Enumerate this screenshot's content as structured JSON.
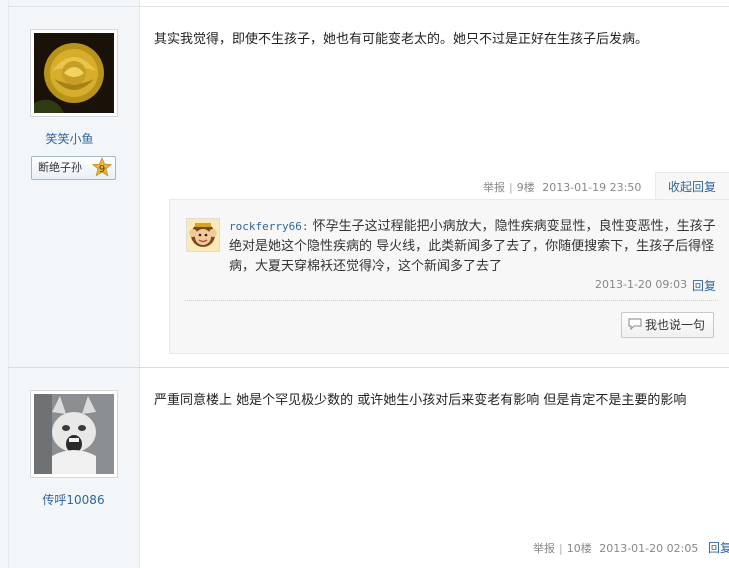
{
  "posts": [
    {
      "username": "笑笑小鱼",
      "badge": "断绝子孙",
      "level": "9",
      "text": "其实我觉得，即使不生孩子，她也有可能变老太的。她只不过是正好在生孩子后发病。",
      "report": "举报",
      "floor": "9楼",
      "time": "2013-01-19 23:50",
      "collapse": "收起回复",
      "replies": [
        {
          "user": "rockferry66:",
          "text": "怀孕生子这过程能把小病放大，隐性疾病变显性，良性变恶性，生孩子绝对是她这个隐性疾病的 导火线，此类新闻多了去了，你随便搜索下，生孩子后得怪病，大夏天穿棉袄还觉得冷，这个新闻多了去了",
          "time": "2013-1-20 09:03",
          "reply": "回复"
        }
      ],
      "say_button": "我也说一句"
    },
    {
      "username": "传呼10086",
      "text": "严重同意楼上 她是个罕见极少数的 或许她生小孩对后来变老有影响 但是肯定不是主要的影响",
      "report": "举报",
      "floor": "10楼",
      "time": "2013-01-20 02:05",
      "reply": "回复"
    }
  ],
  "colors": {
    "link": "#31669b",
    "sidebar": "#f3f6f9",
    "badge_star": "#e8b73a"
  }
}
